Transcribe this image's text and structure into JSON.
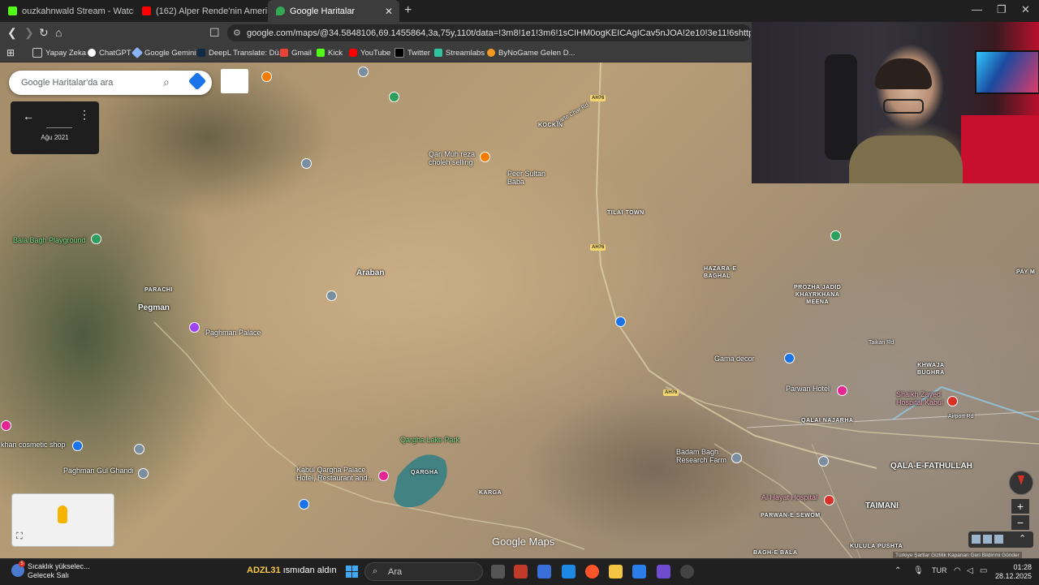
{
  "browser": {
    "tabs": [
      {
        "title": "ouzkahnwald Stream - Watch Live",
        "favicon_color": "#53fc18"
      },
      {
        "title": "(162) Alper Rende'nin Amerikan Polis",
        "favicon_color": "#ff0000"
      },
      {
        "title": "Google Haritalar",
        "favicon_color": "#34a853"
      }
    ],
    "new_tab": "+",
    "url": "google.com/maps/@34.5848106,69.1455864,3a,75y,110t/data=!3m8!1e1!3m6!1sCIHM0ogKEICAgICav5nJOA!2e10!3e11!6shttps:%2F%2Flh3.googleus...",
    "bookmarks": [
      {
        "label": "Yapay Zeka",
        "icon_color": "#d8d8d8"
      },
      {
        "label": "ChatGPT",
        "icon_color": "#ffffff"
      },
      {
        "label": "Google Gemini",
        "icon_color": "#8ab4f8"
      },
      {
        "label": "DeepL Translate: Dü...",
        "icon_color": "#0f2b46"
      },
      {
        "label": "Gmail",
        "icon_color": "#ea4335"
      },
      {
        "label": "Kick",
        "icon_color": "#53fc18"
      },
      {
        "label": "YouTube",
        "icon_color": "#ff0000"
      },
      {
        "label": "Twitter",
        "icon_color": "#000000"
      },
      {
        "label": "Streamlabs",
        "icon_color": "#31c3a2"
      },
      {
        "label": "ByNoGame Gelen D...",
        "icon_color": "#f29b1f"
      }
    ]
  },
  "maps": {
    "search_placeholder": "Google Haritalar'da ara",
    "streetview_date": "Ağu 2021",
    "watermark": "Google Maps",
    "attribution": "Türkiye   Şartlar   Gizlilik   Kapanan Geri Bildirimi Gönder",
    "labels": {
      "bala_bagh": "Bala Bagh Playground",
      "parachi": "PARACHI",
      "pegman_town": "Pegman",
      "paghman_palace": "Paghman Palace",
      "khan_cosmetic": "khan cosmetic shop",
      "paghman_gul": "Paghman Gul Ghandi",
      "araban": "Araban",
      "qari": "Qari Muh reza\ncholeh selling",
      "peer_sultan": "Peer Sultan\nBaba",
      "kockin": "KOCKIN",
      "tilai_town": "TILAI TOWN",
      "qargha_park": "Qargha Lake Park",
      "qargha": "QARGHA",
      "kabul_qargha": "Kabul Qargha Palace\nHotel, Restaurant and...",
      "karga": "KARGA",
      "hazara": "HAZARA-E\nBAGHAL",
      "prozha": "PROZHA JADID\nKHAYRKHANA\nMEENA",
      "gama": "Gama decor",
      "parwan_hotel": "Parwan Hotel",
      "khwaja": "KHWAJA\nBUGHRA",
      "sheikh_zayed": "Shaikh Zayed\nHospital Kabul",
      "qalai": "QALAI NAJARHA",
      "badam_bagh": "Badam Bagh\nResearch Farm",
      "qala_fathullah": "QALA-E-FATHULLAH",
      "al_hayat": "Al Hayat Hospital",
      "parwan_sewom": "PARWAN-E SEWOM",
      "taimani": "TAIMANI",
      "kulula": "KULULA PUSHTA",
      "bagh_bala": "BAGH-E BALA",
      "paymonar": "PAY M",
      "taikan_rd": "Taikan Rd",
      "airport_rd": "Airport Rd",
      "karte_char": "Karte Char Rd",
      "ah76": "AH76"
    }
  },
  "taskbar": {
    "weather_line1": "Sıcaklık yükselec...",
    "weather_line2": "Gelecek Salı",
    "weather_badge": "5",
    "promo_code": "ADZL31",
    "promo_text": "ısmıdan aldın",
    "search_label": "Ara",
    "lang": "TUR",
    "time": "01:28",
    "date": "28.12.2025"
  }
}
